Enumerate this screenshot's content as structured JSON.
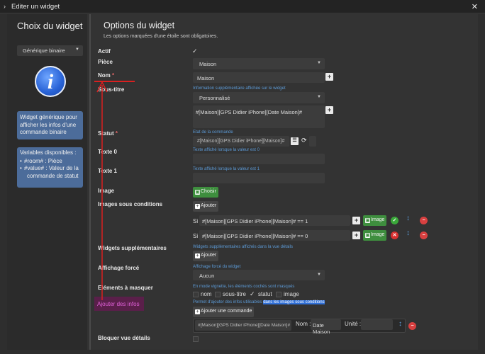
{
  "titlebar": {
    "icon": "chevron-right-icon",
    "title": "Editer un widget",
    "close": "✕"
  },
  "left": {
    "title": "Choix du widget",
    "select_value": "Générique binaire",
    "info_glyph": "i",
    "description": "Widget générique pour afficher les infos d'une commande binaire",
    "vars_title": "Variables disponibles :",
    "vars": [
      "#room# : Pièce",
      "#value# : Valeur de la",
      "commande de statut"
    ]
  },
  "main": {
    "title": "Options du widget",
    "note": "Les options marquées d'une étoile sont obligatoires."
  },
  "form": {
    "actif_label": "Actif",
    "piece_label": "Pièce",
    "piece_value": "Maison",
    "nom_label": "Nom",
    "star": "*",
    "nom_value": "Maison",
    "soustitre_help": "Information supplémentaire affichée sur le widget",
    "soustitre_label": "Sous-titre",
    "soustitre_select": "Personnalisé",
    "soustitre_value": "#[Maison][GPS Didier iPhone][Date Maison]#",
    "statut_label": "Statut",
    "statut_help": "Etat de la commande",
    "statut_value": "#[Maison][GPS Didier iPhone][Maison]#",
    "texte0_label": "Texte 0",
    "texte0_help": "Texte affiché lorsque la valeur est 0",
    "texte1_label": "Texte 1",
    "texte1_help": "Texte affiché lorsque la valeur est 1",
    "image_label": "Image",
    "choisir": "Choisir",
    "images_cond_label": "Images sous conditions",
    "ajouter": "Ajouter",
    "si": "Si",
    "cond1": "#[Maison][GPS Didier iPhone][Maison]# == 1",
    "cond2": "#[Maison][GPS Didier iPhone][Maison]# == 0",
    "image_btn": "Image",
    "widgets_supp_label": "Widgets supplémentaires",
    "widgets_supp_help": "Widgets supplémentaires affichés dans la vue détails",
    "affichage_label": "Affichage forcé",
    "affichage_help": "Affichage forcé du widget",
    "affichage_value": "Aucun",
    "elements_label": "Eléments à masquer",
    "elements_help": "En mode vignette, les éléments cochés sont masqués",
    "opt_nom": "nom",
    "opt_soustitre": "sous-titre",
    "opt_statut": "statut",
    "opt_image": "image",
    "ajouter_infos_label": "Ajouter des infos",
    "ajouter_infos_help": "Permet d'ajouter des infos utilisables",
    "ajouter_infos_help_hl": "dans les images sous conditions",
    "ajouter_commande": "Ajouter une commande",
    "cmd_value": "#[Maison][GPS Didier iPhone][Date Maison]#",
    "nom_short": "Nom :",
    "nom_cmd_value": "Date Maison",
    "unite": "Unité :",
    "bloquer_label": "Bloquer vue détails"
  },
  "colors": {
    "accent_green": "#3e8e3e",
    "link_blue": "#5c9ad6",
    "annotation_red": "#d92020",
    "info_box": "#4c6c9a"
  }
}
